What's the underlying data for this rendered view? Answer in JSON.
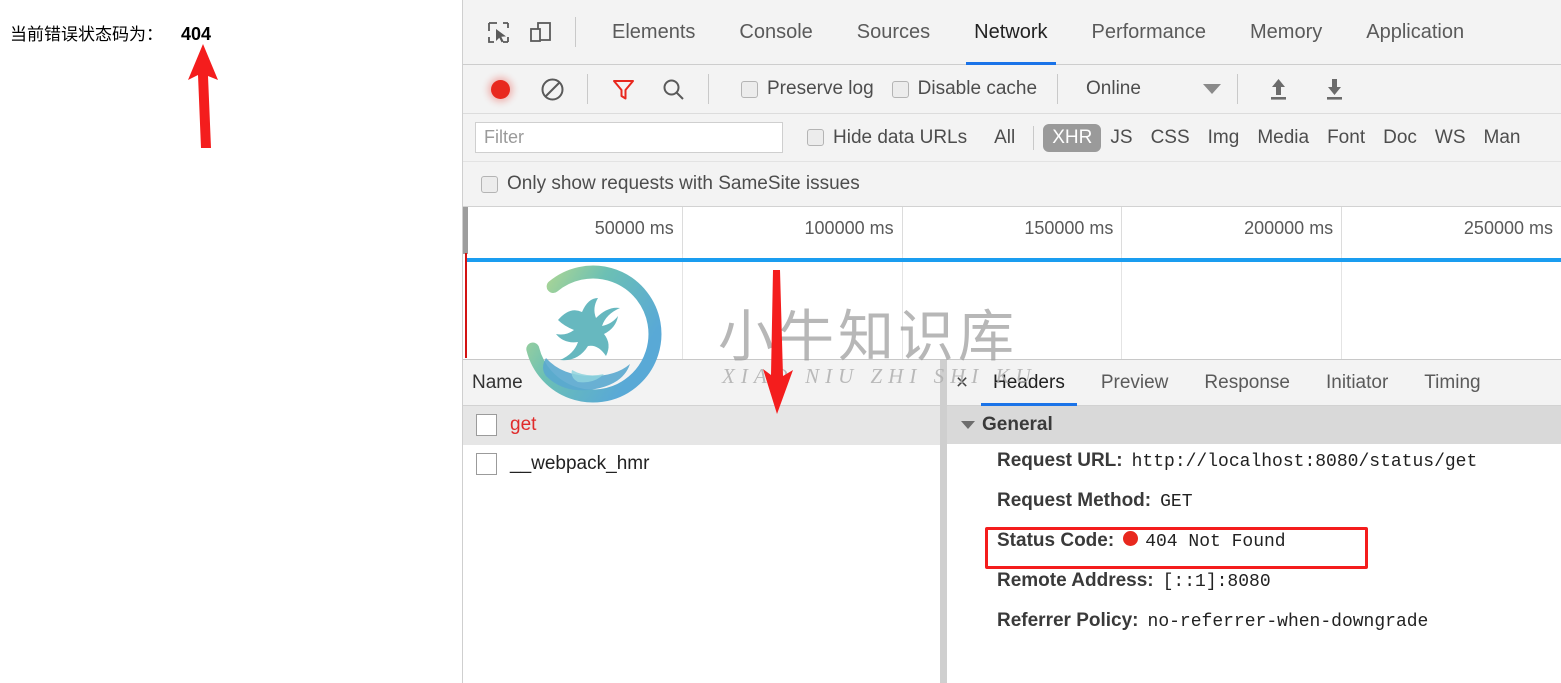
{
  "page": {
    "message_label": "当前错误状态码为：",
    "status_value": "404"
  },
  "devtools": {
    "toolbar_icons": {
      "inspect": "inspect-element-icon",
      "device": "device-toolbar-icon"
    },
    "tabs": [
      {
        "label": "Elements",
        "active": false
      },
      {
        "label": "Console",
        "active": false
      },
      {
        "label": "Sources",
        "active": false
      },
      {
        "label": "Network",
        "active": true
      },
      {
        "label": "Performance",
        "active": false
      },
      {
        "label": "Memory",
        "active": false
      },
      {
        "label": "Application",
        "active": false
      }
    ],
    "controls": {
      "record_title": "record-button",
      "clear_title": "clear-button",
      "filter_title": "filter-toggle",
      "search_title": "search-button",
      "preserve_log": "Preserve log",
      "disable_cache": "Disable cache",
      "throttle_value": "Online",
      "import_title": "import-har-button",
      "export_title": "export-har-button"
    },
    "filterbar": {
      "filter_placeholder": "Filter",
      "filter_value": "",
      "hide_data_urls": "Hide data URLs",
      "types": [
        {
          "label": "All",
          "selected": false
        },
        {
          "label": "XHR",
          "selected": true
        },
        {
          "label": "JS",
          "selected": false
        },
        {
          "label": "CSS",
          "selected": false
        },
        {
          "label": "Img",
          "selected": false
        },
        {
          "label": "Media",
          "selected": false
        },
        {
          "label": "Font",
          "selected": false
        },
        {
          "label": "Doc",
          "selected": false
        },
        {
          "label": "WS",
          "selected": false
        },
        {
          "label": "Man",
          "selected": false
        }
      ]
    },
    "samesite": {
      "label": "Only show requests with SameSite issues"
    },
    "timeline": {
      "ticks": [
        "50000 ms",
        "100000 ms",
        "150000 ms",
        "200000 ms",
        "250000 ms"
      ]
    },
    "requests": {
      "column_header": "Name",
      "rows": [
        {
          "name": "get",
          "selected": true,
          "error": true
        },
        {
          "name": "__webpack_hmr",
          "selected": false,
          "error": false
        }
      ]
    },
    "details": {
      "close_label": "×",
      "tabs": [
        {
          "label": "Headers",
          "active": true
        },
        {
          "label": "Preview",
          "active": false
        },
        {
          "label": "Response",
          "active": false
        },
        {
          "label": "Initiator",
          "active": false
        },
        {
          "label": "Timing",
          "active": false
        }
      ],
      "general_section": "General",
      "fields": [
        {
          "key": "Request URL:",
          "value": "http://localhost:8080/status/get"
        },
        {
          "key": "Request Method:",
          "value": "GET"
        },
        {
          "key": "Status Code:",
          "value": "404 Not Found",
          "dot": true,
          "highlighted": true
        },
        {
          "key": "Remote Address:",
          "value": "[::1]:8080"
        },
        {
          "key": "Referrer Policy:",
          "value": "no-referrer-when-downgrade"
        }
      ]
    }
  },
  "watermark": {
    "chinese": "小牛知识库",
    "pinyin": "XIAO NIU ZHI SHI KU"
  },
  "annotations": {
    "arrow_up_color": "#f41d1d",
    "arrow_down_color": "#f41d1d",
    "highlight_color": "#f41d1d"
  }
}
